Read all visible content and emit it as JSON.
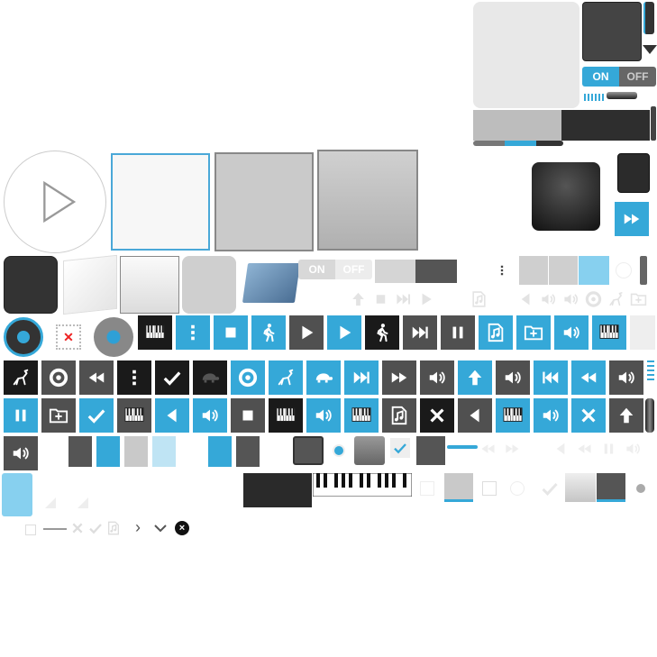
{
  "toggles": {
    "on_label": "ON",
    "off_label": "OFF"
  },
  "icons": {
    "play": "play-icon",
    "stop": "stop-icon",
    "pause": "pause-icon",
    "next": "skip-next-icon",
    "prev": "skip-prev-icon",
    "ffwd": "fast-forward-icon",
    "rew": "rewind-icon",
    "volume": "volume-icon",
    "menu": "menu-dots-icon",
    "walk": "walk-icon",
    "deer": "fast-animal-icon",
    "turtle": "turtle-icon",
    "check": "check-icon",
    "close": "close-icon",
    "up": "arrow-up-icon",
    "left": "arrow-left-icon",
    "piano": "piano-keys-icon",
    "folder": "folder-add-icon",
    "music": "music-file-icon",
    "record": "record-icon"
  },
  "colors": {
    "accent": "#35a8d8",
    "dark": "#505050",
    "black": "#1a1a1a",
    "gray": "#c9c9c9"
  }
}
